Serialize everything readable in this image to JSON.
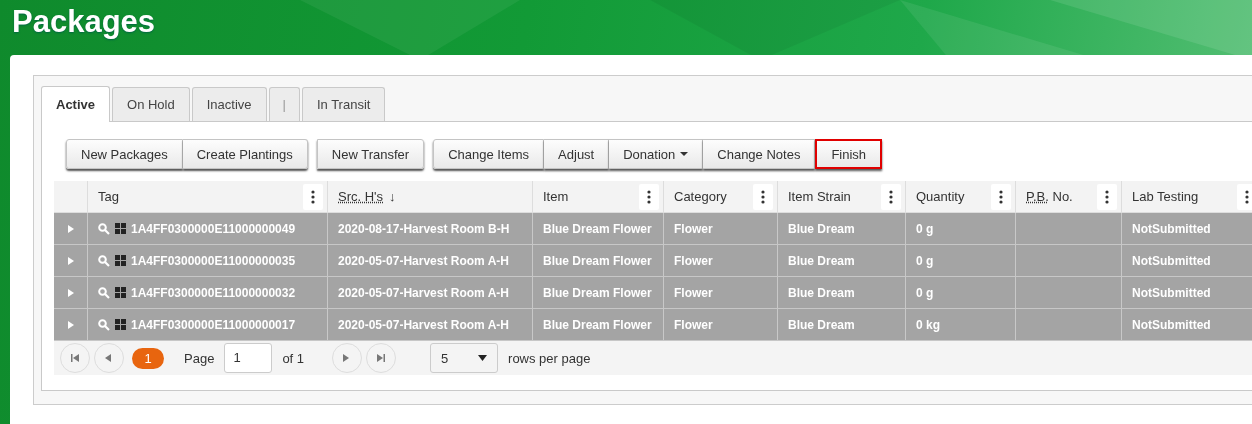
{
  "title": "Packages",
  "tabs": [
    {
      "label": "Active",
      "selected": true,
      "kind": "tab"
    },
    {
      "label": "On Hold",
      "selected": false,
      "kind": "tab"
    },
    {
      "label": "Inactive",
      "selected": false,
      "kind": "tab"
    },
    {
      "label": "|",
      "selected": false,
      "kind": "separator"
    },
    {
      "label": "In Transit",
      "selected": false,
      "kind": "tab"
    }
  ],
  "toolbar": [
    [
      {
        "label": "New Packages",
        "kind": "button",
        "highlighted": false
      },
      {
        "label": "Create Plantings",
        "kind": "button",
        "highlighted": false
      }
    ],
    [
      {
        "label": "New Transfer",
        "kind": "button",
        "highlighted": false
      }
    ],
    [
      {
        "label": "Change Items",
        "kind": "button",
        "highlighted": false
      },
      {
        "label": "Adjust",
        "kind": "button",
        "highlighted": false
      },
      {
        "label": "Donation",
        "kind": "dropdown",
        "highlighted": false
      },
      {
        "label": "Change Notes",
        "kind": "button",
        "highlighted": false
      },
      {
        "label": "Finish",
        "kind": "button",
        "highlighted": true
      }
    ]
  ],
  "table": {
    "columns": [
      {
        "label": "Tag",
        "abbr": false,
        "menu": true
      },
      {
        "label": "Src. H's",
        "abbr": true,
        "sort_indicator": "↓",
        "menu": false
      },
      {
        "label": "Item",
        "abbr": false,
        "menu": true
      },
      {
        "label": "Category",
        "abbr": false,
        "menu": true
      },
      {
        "label": "Item Strain",
        "abbr": false,
        "menu": true
      },
      {
        "label": "Quantity",
        "abbr": false,
        "menu": true
      },
      {
        "label": "P.B.",
        "suffix": " No.",
        "abbr": true,
        "menu": true
      },
      {
        "label": "Lab Testing",
        "abbr": false,
        "menu": true
      }
    ],
    "rows": [
      {
        "selected": true,
        "cells": [
          "1A4FF0300000E11000000049",
          "2020-08-17-Harvest Room B-H",
          "Blue Dream Flower",
          "Flower",
          "Blue Dream",
          "0 g",
          "",
          "NotSubmitted"
        ]
      },
      {
        "selected": true,
        "cells": [
          "1A4FF0300000E11000000035",
          "2020-05-07-Harvest Room A-H",
          "Blue Dream Flower",
          "Flower",
          "Blue Dream",
          "0 g",
          "",
          "NotSubmitted"
        ]
      },
      {
        "selected": true,
        "cells": [
          "1A4FF0300000E11000000032",
          "2020-05-07-Harvest Room A-H",
          "Blue Dream Flower",
          "Flower",
          "Blue Dream",
          "0 g",
          "",
          "NotSubmitted"
        ]
      },
      {
        "selected": true,
        "cells": [
          "1A4FF0300000E11000000017",
          "2020-05-07-Harvest Room A-H",
          "Blue Dream Flower",
          "Flower",
          "Blue Dream",
          "0 kg",
          "",
          "NotSubmitted"
        ]
      }
    ]
  },
  "pager": {
    "current_page": "1",
    "page_label": "Page",
    "page_value": "1",
    "of_label": "of 1",
    "page_size": "5",
    "page_size_label": "rows per page"
  }
}
